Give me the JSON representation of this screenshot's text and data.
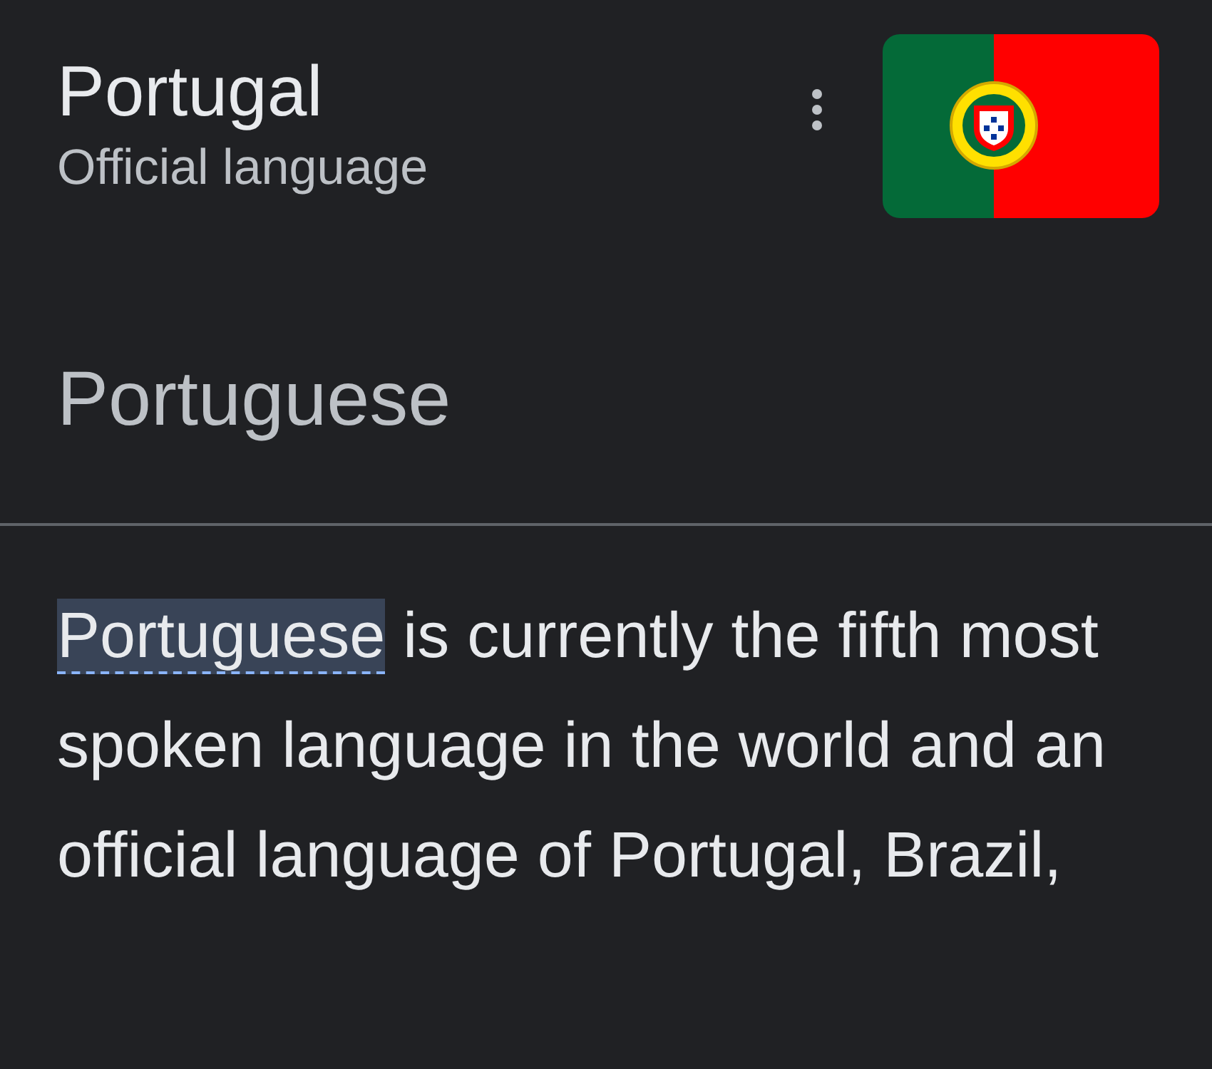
{
  "header": {
    "title": "Portugal",
    "subtitle": "Official language"
  },
  "answer": "Portuguese",
  "description": {
    "term": "Portuguese",
    "term_selected": true,
    "text": " is currently the fifth most spoken language in the world and an official language of Portugal, Brazil,"
  }
}
